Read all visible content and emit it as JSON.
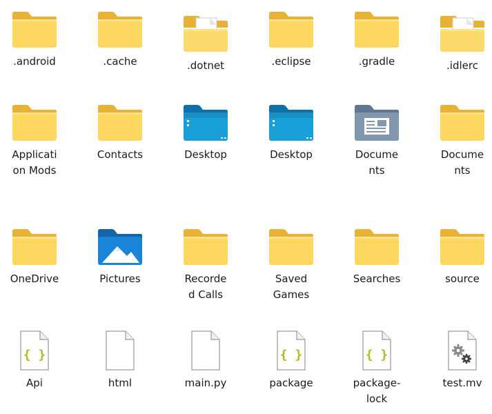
{
  "items": [
    {
      "name": "android-folder",
      "label": ".android",
      "icon": "folder"
    },
    {
      "name": "cache-folder",
      "label": ".cache",
      "icon": "folder"
    },
    {
      "name": "dotnet-folder",
      "label": ".dotnet",
      "icon": "folder-with-file"
    },
    {
      "name": "eclipse-folder",
      "label": ".eclipse",
      "icon": "folder"
    },
    {
      "name": "gradle-folder",
      "label": ".gradle",
      "icon": "folder"
    },
    {
      "name": "idlerc-folder",
      "label": ".idlerc",
      "icon": "folder-with-file"
    },
    {
      "name": "application-mods-folder",
      "label": "Applicati\non Mods",
      "icon": "folder"
    },
    {
      "name": "contacts-folder",
      "label": "Contacts",
      "icon": "folder"
    },
    {
      "name": "desktop-folder-1",
      "label": "Desktop",
      "icon": "desktop-folder"
    },
    {
      "name": "desktop-folder-2",
      "label": "Desktop",
      "icon": "desktop-folder"
    },
    {
      "name": "documents-folder-1",
      "label": "Docume\nnts",
      "icon": "documents-folder"
    },
    {
      "name": "documents-folder-2",
      "label": "Docume\nnts",
      "icon": "folder"
    },
    {
      "name": "onedrive-folder",
      "label": "OneDrive",
      "icon": "folder"
    },
    {
      "name": "pictures-folder",
      "label": "Pictures",
      "icon": "pictures-folder"
    },
    {
      "name": "recorded-calls-folder",
      "label": "Recorde\nd Calls",
      "icon": "folder"
    },
    {
      "name": "saved-games-folder",
      "label": "Saved\nGames",
      "icon": "folder"
    },
    {
      "name": "searches-folder",
      "label": "Searches",
      "icon": "folder"
    },
    {
      "name": "source-folder",
      "label": "source",
      "icon": "folder"
    },
    {
      "name": "api-file",
      "label": "Api",
      "icon": "json-file"
    },
    {
      "name": "html-file",
      "label": "html",
      "icon": "blank-file"
    },
    {
      "name": "main-py-file",
      "label": "main.py",
      "icon": "blank-file"
    },
    {
      "name": "package-file",
      "label": "package",
      "icon": "json-file"
    },
    {
      "name": "package-lock-file",
      "label": "package-\nlock",
      "icon": "json-file"
    },
    {
      "name": "test-mv-file",
      "label": "test.mv",
      "icon": "settings-file"
    }
  ],
  "colors": {
    "folder_back": "#e8b236",
    "folder_front": "#fdd760",
    "desktop_blue": "#1aa0d8",
    "pictures_blue": "#1a84d8",
    "json_accent": "#b4b820"
  }
}
